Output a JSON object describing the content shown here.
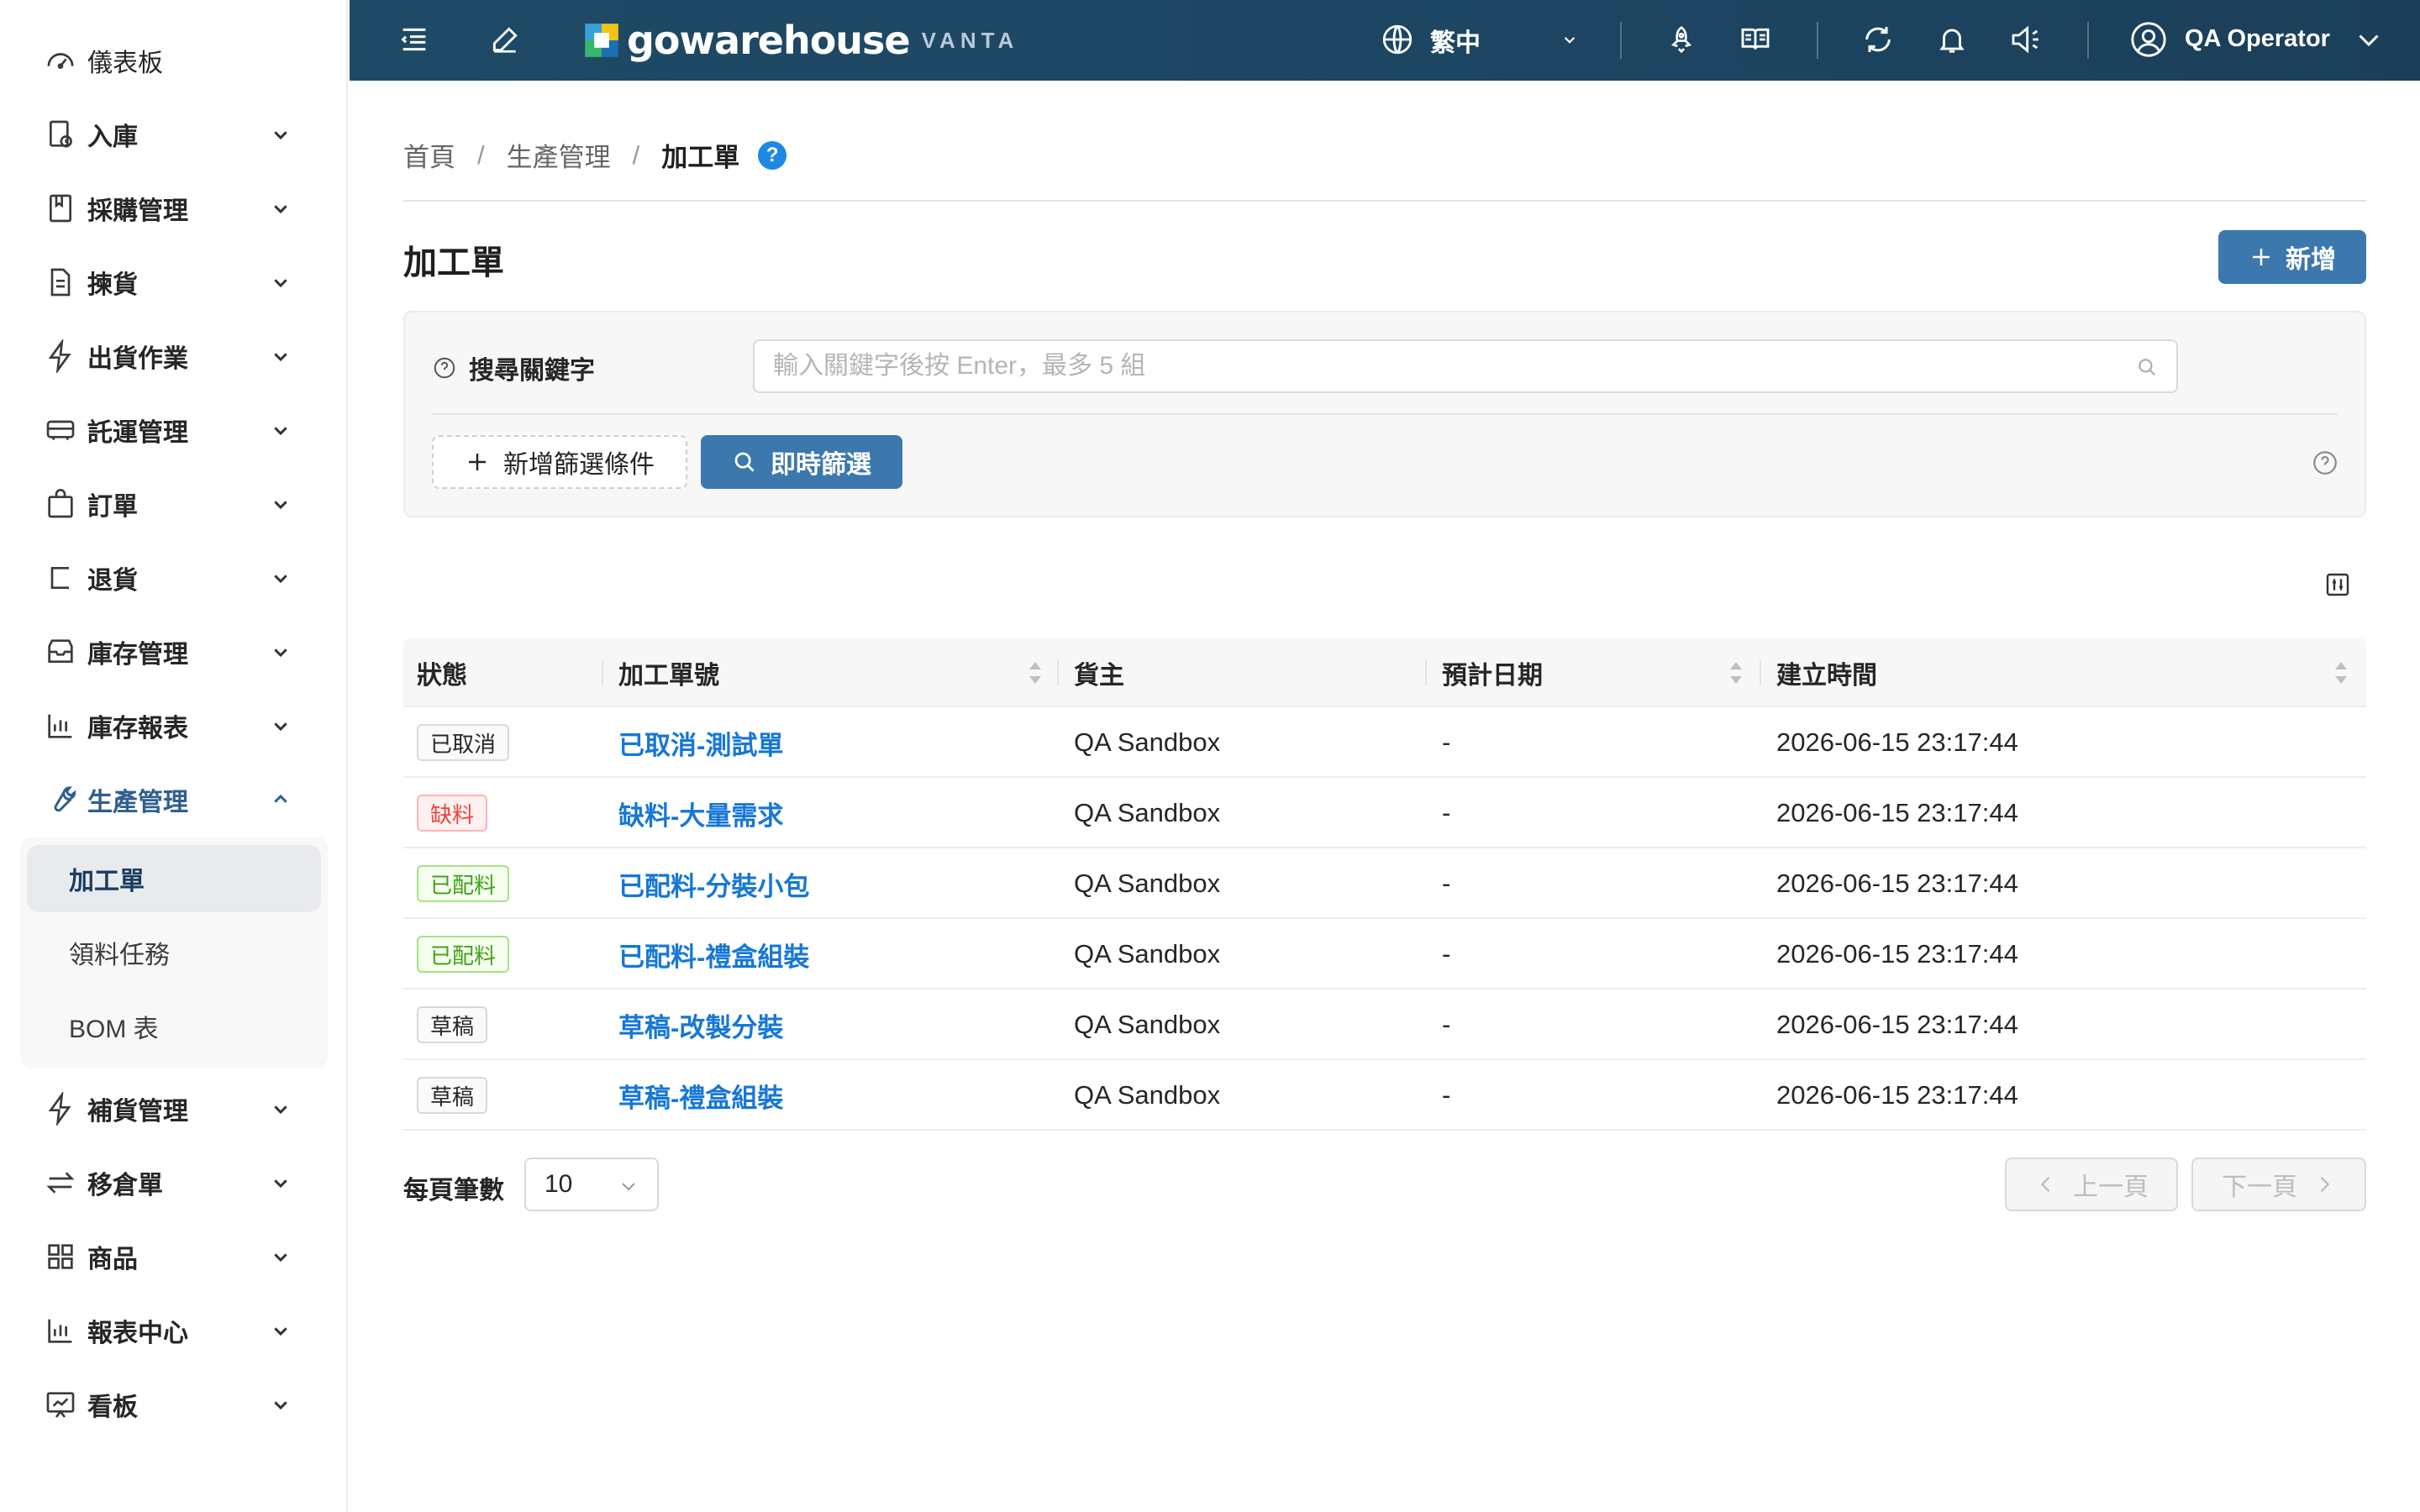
{
  "sidebar": {
    "items": [
      {
        "label": "儀表板",
        "icon": "dashboard-icon"
      },
      {
        "label": "入庫",
        "icon": "inbound-icon"
      },
      {
        "label": "採購管理",
        "icon": "purchase-icon"
      },
      {
        "label": "揀貨",
        "icon": "picking-icon"
      },
      {
        "label": "出貨作業",
        "icon": "shipping-icon"
      },
      {
        "label": "託運管理",
        "icon": "truck-icon"
      },
      {
        "label": "訂單",
        "icon": "bag-icon"
      },
      {
        "label": "退貨",
        "icon": "return-icon"
      },
      {
        "label": "庫存管理",
        "icon": "inventory-icon"
      },
      {
        "label": "庫存報表",
        "icon": "bar-chart-icon"
      },
      {
        "label": "生產管理",
        "icon": "wrench-icon"
      },
      {
        "label": "補貨管理",
        "icon": "lightning-icon"
      },
      {
        "label": "移倉單",
        "icon": "transfer-icon"
      },
      {
        "label": "商品",
        "icon": "grid-icon"
      },
      {
        "label": "報表中心",
        "icon": "report-icon"
      },
      {
        "label": "看板",
        "icon": "board-icon"
      }
    ],
    "submenu": [
      "加工單",
      "領料任務",
      "BOM 表"
    ]
  },
  "topbar": {
    "logo_text": "gowarehouse",
    "logo_sub": "VANTA",
    "language": "繁中",
    "user": "QA Operator"
  },
  "breadcrumb": {
    "home": "首頁",
    "section": "生產管理",
    "current": "加工單",
    "help": "?"
  },
  "page": {
    "title": "加工單",
    "add_label": "新增"
  },
  "filter": {
    "keyword_label": "搜尋關鍵字",
    "search_placeholder": "輸入關鍵字後按 Enter，最多 5 組",
    "add_condition": "新增篩選條件",
    "live_filter": "即時篩選"
  },
  "table": {
    "headers": [
      "狀態",
      "加工單號",
      "貨主",
      "預計日期",
      "建立時間"
    ],
    "rows": [
      {
        "status": "已取消",
        "status_type": "default",
        "number": "已取消-測試單",
        "owner": "QA Sandbox",
        "date": "-",
        "created": "2026-06-15 23:17:44"
      },
      {
        "status": "缺料",
        "status_type": "error",
        "number": "缺料-大量需求",
        "owner": "QA Sandbox",
        "date": "-",
        "created": "2026-06-15 23:17:44"
      },
      {
        "status": "已配料",
        "status_type": "success",
        "number": "已配料-分裝小包",
        "owner": "QA Sandbox",
        "date": "-",
        "created": "2026-06-15 23:17:44"
      },
      {
        "status": "已配料",
        "status_type": "success",
        "number": "已配料-禮盒組裝",
        "owner": "QA Sandbox",
        "date": "-",
        "created": "2026-06-15 23:17:44"
      },
      {
        "status": "草稿",
        "status_type": "default",
        "number": "草稿-改製分裝",
        "owner": "QA Sandbox",
        "date": "-",
        "created": "2026-06-15 23:17:44"
      },
      {
        "status": "草稿",
        "status_type": "default",
        "number": "草稿-禮盒組裝",
        "owner": "QA Sandbox",
        "date": "-",
        "created": "2026-06-15 23:17:44"
      }
    ]
  },
  "pagination": {
    "page_size_label": "每頁筆數",
    "page_size": "10",
    "prev": "上一頁",
    "next": "下一頁"
  },
  "colors": {
    "topbar": "#1f4a66",
    "primary": "#3c78ad",
    "link": "#1677d6",
    "active_nav": "#2f5f8d"
  }
}
